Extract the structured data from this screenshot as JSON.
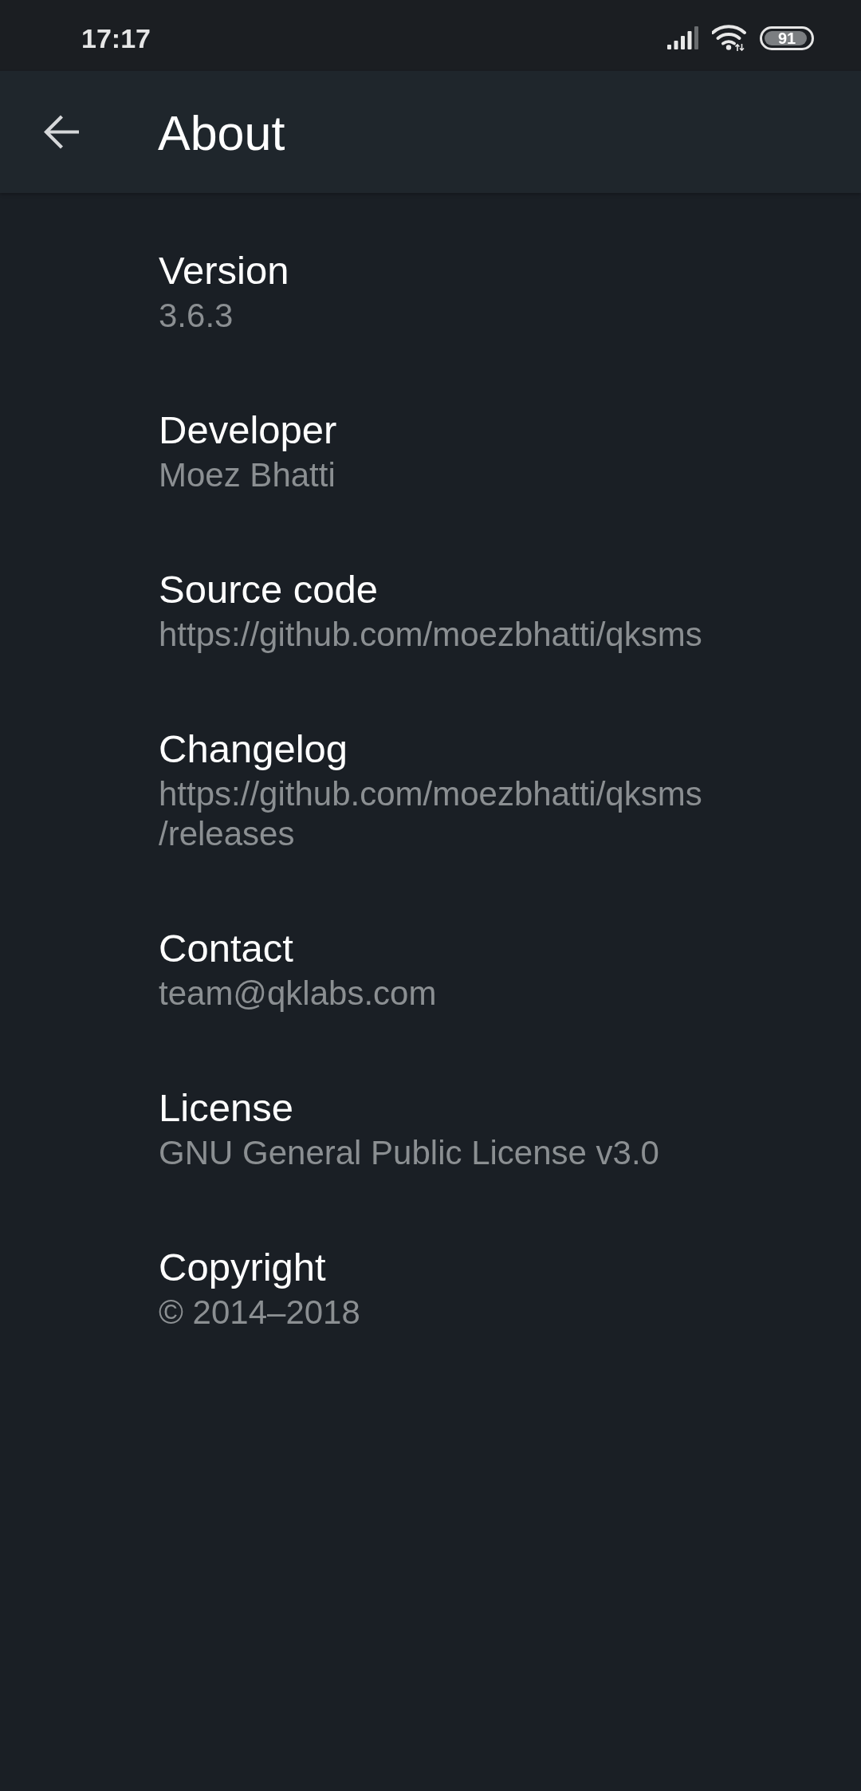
{
  "status_bar": {
    "time": "17:17",
    "battery": "91"
  },
  "toolbar": {
    "title": "About"
  },
  "items": [
    {
      "title": "Version",
      "summary": "3.6.3"
    },
    {
      "title": "Developer",
      "summary": "Moez Bhatti"
    },
    {
      "title": "Source code",
      "summary": "https://github.com/moezbhatti/qksms"
    },
    {
      "title": "Changelog",
      "summary": "https://github.com/moezbhatti/qksms/releases"
    },
    {
      "title": "Contact",
      "summary": "team@qklabs.com"
    },
    {
      "title": "License",
      "summary": "GNU General Public License v3.0"
    },
    {
      "title": "Copyright",
      "summary": "© 2014–2018"
    }
  ]
}
